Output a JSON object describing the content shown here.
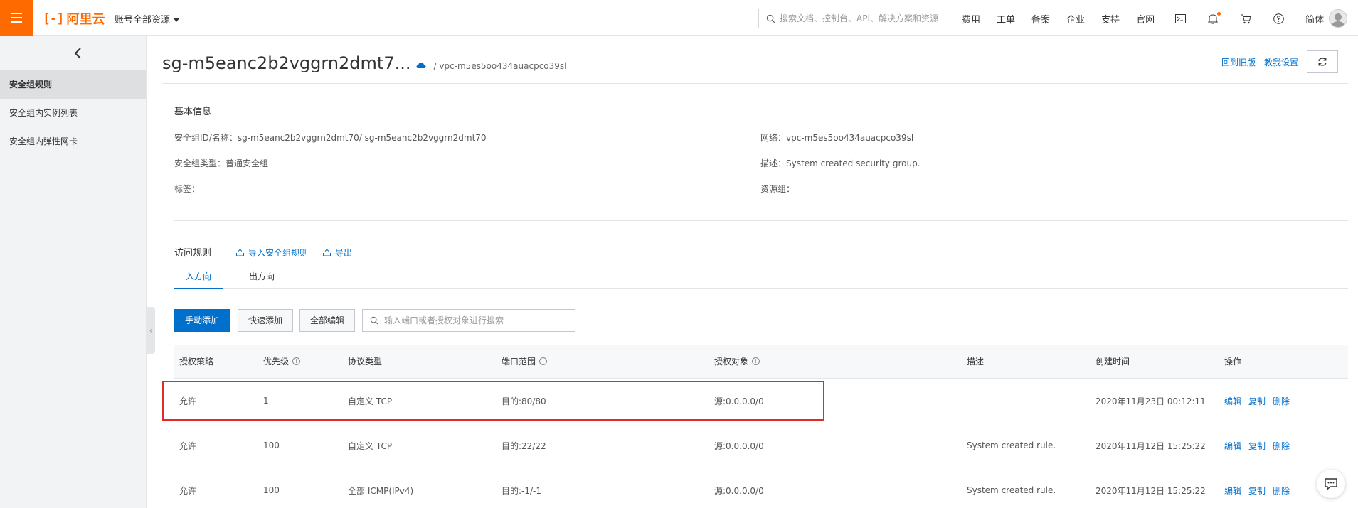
{
  "topbar": {
    "logo_text": "阿里云",
    "account_switch": "账号全部资源",
    "search_placeholder": "搜索文档、控制台、API、解决方案和资源",
    "nav": [
      "费用",
      "工单",
      "备案",
      "企业",
      "支持",
      "官网"
    ],
    "language": "简体",
    "icons": [
      "terminal-icon",
      "bell-icon",
      "cart-icon",
      "help-icon"
    ],
    "accent": "#ff6a00"
  },
  "sidebar": {
    "items": [
      {
        "label": "安全组规则",
        "active": true
      },
      {
        "label": "安全组内实例列表",
        "active": false
      },
      {
        "label": "安全组内弹性网卡",
        "active": false
      }
    ]
  },
  "header": {
    "title": "sg-m5eanc2b2vggrn2dmt7...",
    "vpc": "/ vpc-m5es5oo434auacpco39sl",
    "back_old": "回到旧版",
    "tutorial": "教我设置"
  },
  "basic_info": {
    "title": "基本信息",
    "id_name_label": "安全组ID/名称：",
    "id_name_value": "sg-m5eanc2b2vggrn2dmt70/ sg-m5eanc2b2vggrn2dmt70",
    "type_label": "安全组类型：",
    "type_value": "普通安全组",
    "tags_label": "标签：",
    "network_label": "网络：",
    "network_value": "vpc-m5es5oo434auacpco39sl",
    "desc_label": "描述：",
    "desc_value": "System created security group.",
    "resource_group_label": "资源组："
  },
  "rules": {
    "title": "访问规则",
    "import_label": "导入安全组规则",
    "export_label": "导出",
    "tabs": [
      "入方向",
      "出方向"
    ],
    "active_tab": 0,
    "buttons": {
      "manual_add": "手动添加",
      "quick_add": "快速添加",
      "edit_all": "全部编辑"
    },
    "search_placeholder": "输入端口或者授权对象进行搜索",
    "columns": [
      "授权策略",
      "优先级",
      "协议类型",
      "端口范围",
      "授权对象",
      "描述",
      "创建时间",
      "操作"
    ],
    "rows": [
      {
        "policy": "允许",
        "priority": "1",
        "protocol": "自定义 TCP",
        "port": "目的:80/80",
        "source": "源:0.0.0.0/0",
        "desc": "",
        "created": "2020年11月23日 00:12:11"
      },
      {
        "policy": "允许",
        "priority": "100",
        "protocol": "自定义 TCP",
        "port": "目的:22/22",
        "source": "源:0.0.0.0/0",
        "desc": "System created rule.",
        "created": "2020年11月12日 15:25:22"
      },
      {
        "policy": "允许",
        "priority": "100",
        "protocol": "全部 ICMP(IPv4)",
        "port": "目的:-1/-1",
        "source": "源:0.0.0.0/0",
        "desc": "System created rule.",
        "created": "2020年11月12日 15:25:22"
      }
    ],
    "ops": [
      "编辑",
      "复制",
      "删除"
    ]
  }
}
